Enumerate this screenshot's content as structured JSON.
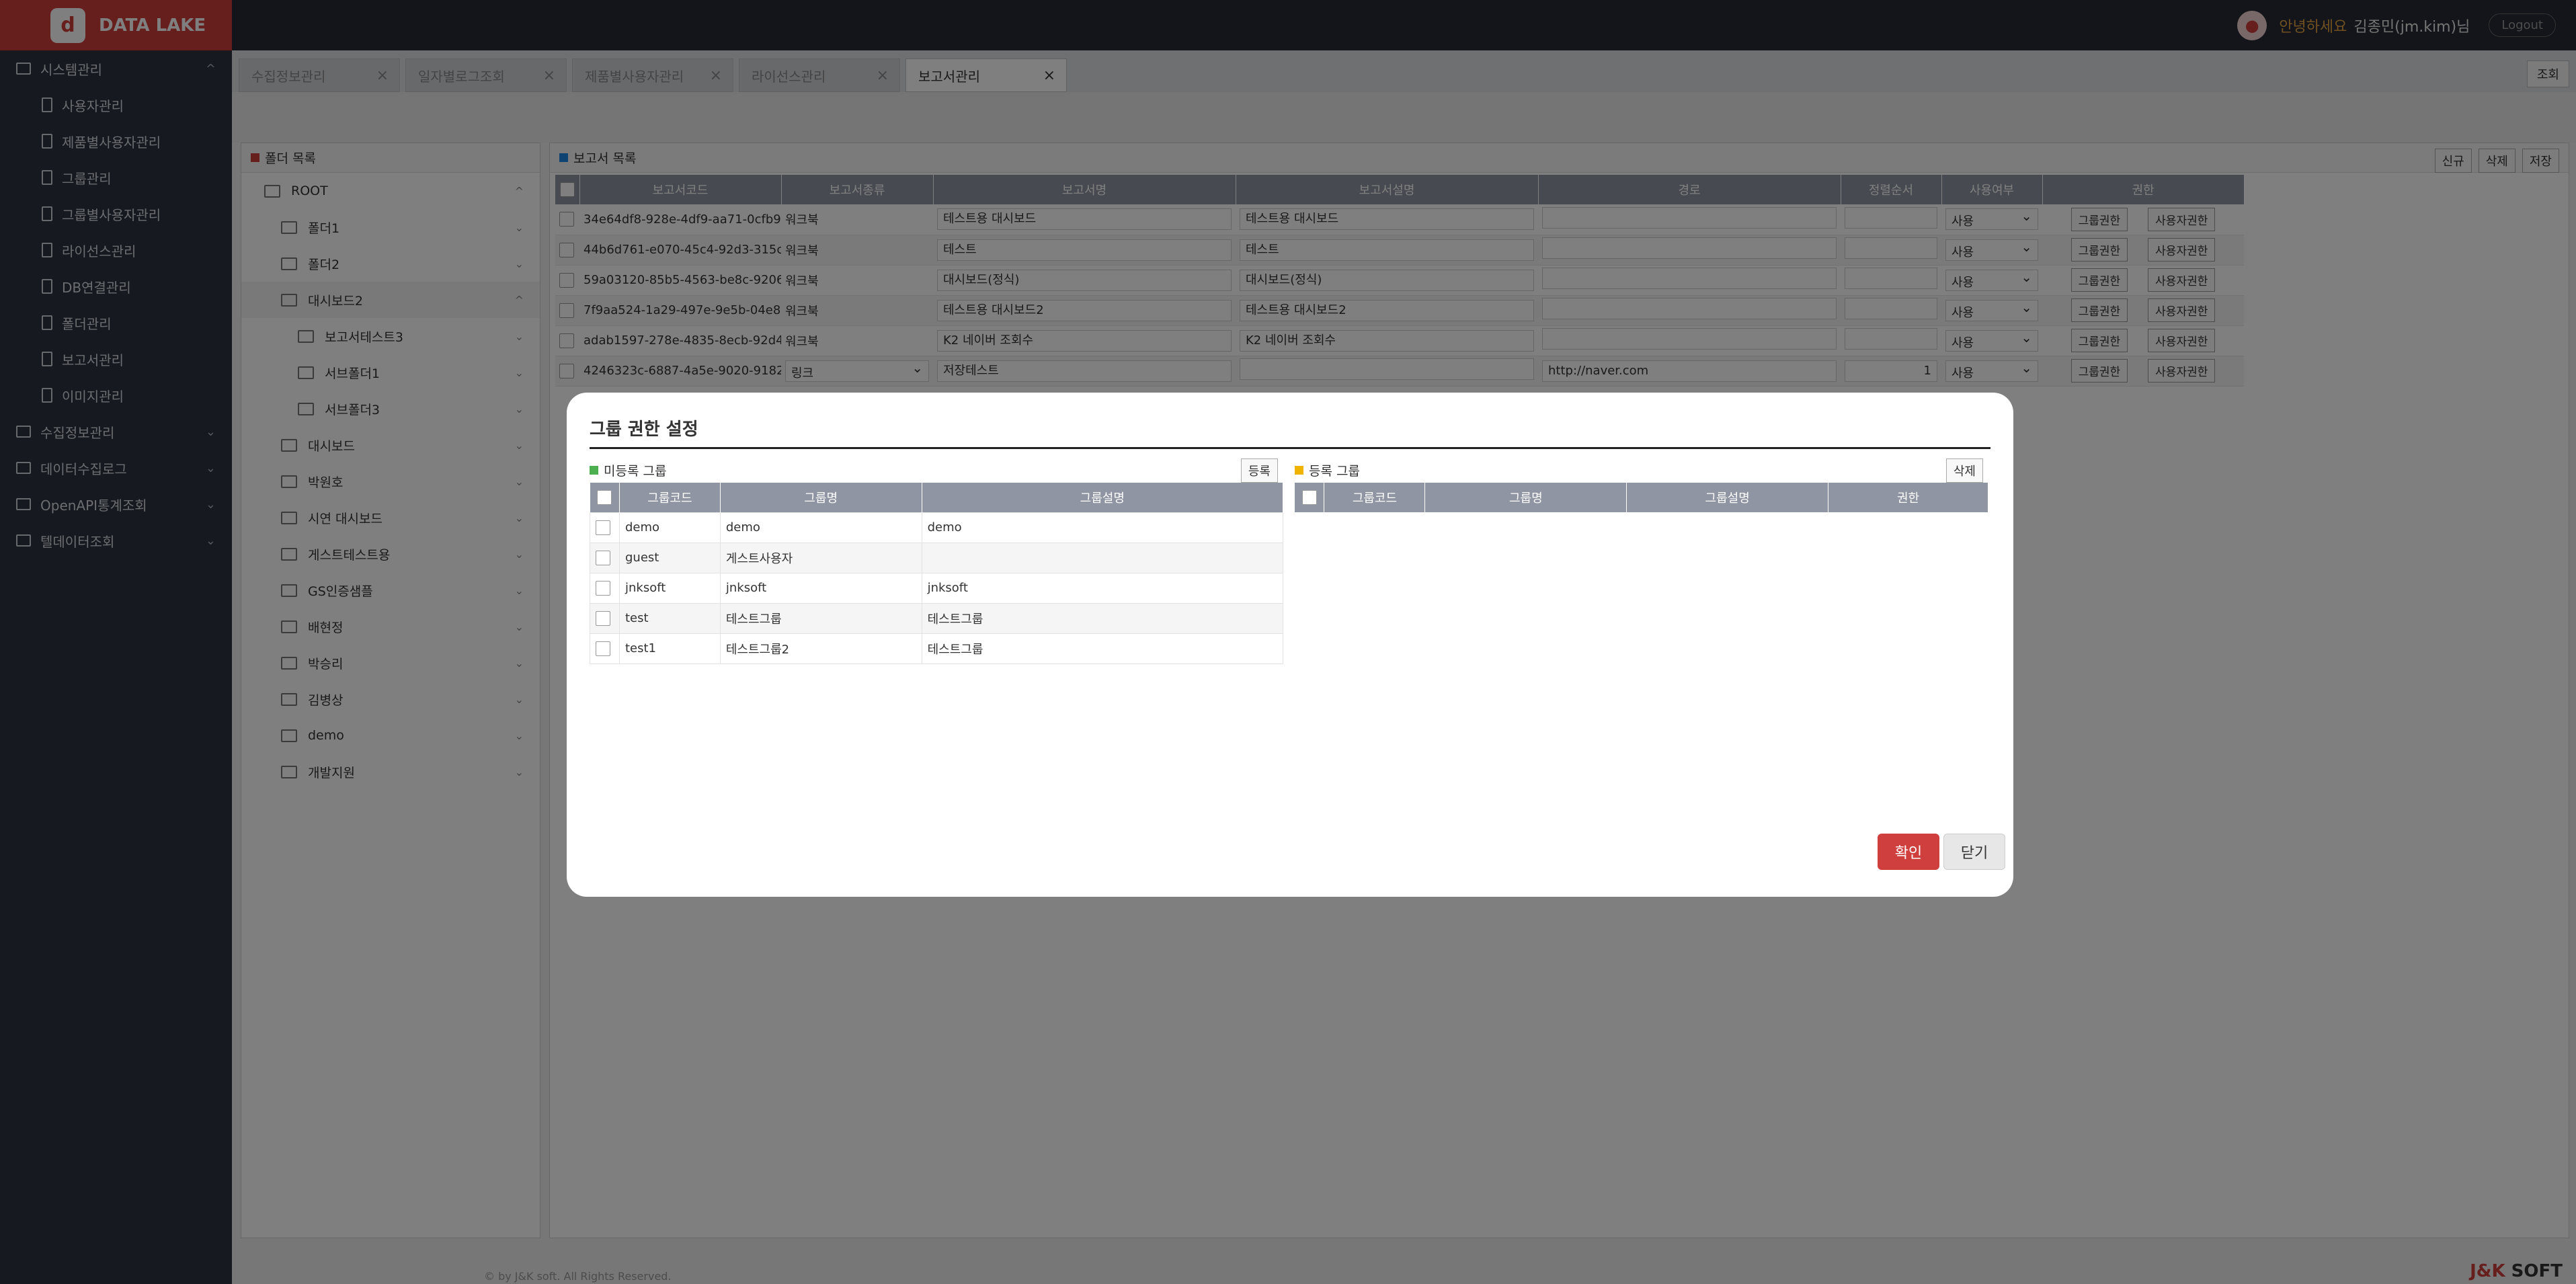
{
  "app": {
    "logo_text": "DATA LAKE",
    "logo_glyph": "d"
  },
  "topbar": {
    "greeting": "안녕하세요",
    "user": "김종민(jm.kim)님",
    "logout": "Logout"
  },
  "sidebar": {
    "groups": [
      {
        "label": "시스템관리",
        "expanded": true,
        "chevron": "^",
        "items": [
          "사용자관리",
          "제품별사용자관리",
          "그룹관리",
          "그룹별사용자관리",
          "라이선스관리",
          "DB연결관리",
          "폴더관리",
          "보고서관리",
          "이미지관리"
        ]
      },
      {
        "label": "수집정보관리",
        "chevron": "⌄"
      },
      {
        "label": "데이터수집로그",
        "chevron": "⌄"
      },
      {
        "label": "OpenAPI통계조회",
        "chevron": "⌄"
      },
      {
        "label": "텔데이터조회",
        "chevron": "⌄"
      }
    ]
  },
  "tabs": [
    {
      "label": "수집정보관리",
      "close": "×"
    },
    {
      "label": "일자별로그조회",
      "close": "×"
    },
    {
      "label": "제품별사용자관리",
      "close": "×"
    },
    {
      "label": "라이선스관리",
      "close": "×"
    },
    {
      "label": "보고서관리",
      "close": "×",
      "active": true
    }
  ],
  "view_button": "조회",
  "folder_panel": {
    "title": "폴더 목록",
    "tree": [
      {
        "label": "ROOT",
        "level": 0,
        "chev": "^"
      },
      {
        "label": "폴더1",
        "level": 1,
        "chev": "⌄"
      },
      {
        "label": "폴더2",
        "level": 1,
        "chev": "⌄"
      },
      {
        "label": "대시보드2",
        "level": 1,
        "chev": "^",
        "selected": true
      },
      {
        "label": "보고서테스트3",
        "level": 2,
        "chev": "⌄"
      },
      {
        "label": "서브폴더1",
        "level": 2,
        "chev": "⌄"
      },
      {
        "label": "서브폴더3",
        "level": 2,
        "chev": "⌄"
      },
      {
        "label": "대시보드",
        "level": 1,
        "chev": "⌄"
      },
      {
        "label": "박원호",
        "level": 1,
        "chev": "⌄"
      },
      {
        "label": "시연 대시보드",
        "level": 1,
        "chev": "⌄"
      },
      {
        "label": "게스트테스트용",
        "level": 1,
        "chev": "⌄"
      },
      {
        "label": "GS인증샘플",
        "level": 1,
        "chev": "⌄"
      },
      {
        "label": "배현정",
        "level": 1,
        "chev": "⌄"
      },
      {
        "label": "박승리",
        "level": 1,
        "chev": "⌄"
      },
      {
        "label": "김병상",
        "level": 1,
        "chev": "⌄"
      },
      {
        "label": "demo",
        "level": 1,
        "chev": "⌄"
      },
      {
        "label": "개발지원",
        "level": 1,
        "chev": "⌄"
      }
    ]
  },
  "report_panel": {
    "title": "보고서 목록",
    "actions": [
      "신규",
      "삭제",
      "저장"
    ],
    "columns": [
      "보고서코드",
      "보고서종류",
      "보고서명",
      "보고서설명",
      "경로",
      "정렬순서",
      "사용여부",
      "권한"
    ],
    "rows": [
      {
        "code": "34e64df8-928e-4df9-aa71-0cfb9...",
        "type": "워크북",
        "name": "테스트용 대시보드",
        "desc": "테스트용 대시보드",
        "path": "",
        "order": "",
        "use": "사용"
      },
      {
        "code": "44b6d761-e070-45c4-92d3-315c...",
        "type": "워크북",
        "name": "테스트",
        "desc": "테스트",
        "path": "",
        "order": "",
        "use": "사용"
      },
      {
        "code": "59a03120-85b5-4563-be8c-9206...",
        "type": "워크북",
        "name": "대시보드(정식)",
        "desc": "대시보드(정식)",
        "path": "",
        "order": "",
        "use": "사용"
      },
      {
        "code": "7f9aa524-1a29-497e-9e5b-04e8...",
        "type": "워크북",
        "name": "테스트용 대시보드2",
        "desc": "테스트용 대시보드2",
        "path": "",
        "order": "",
        "use": "사용"
      },
      {
        "code": "adab1597-278e-4835-8ecb-92d4...",
        "type": "워크북",
        "name": "K2 네이버 조회수",
        "desc": "K2 네이버 조회수",
        "path": "",
        "order": "",
        "use": "사용"
      },
      {
        "code": "4246323c-6887-4a5e-9020-9182...",
        "type": "링크",
        "name": "저장테스트",
        "desc": "",
        "path": "http://naver.com",
        "order": "1",
        "use": "사용"
      }
    ],
    "group_btn": "그룹권한",
    "user_btn": "사용자권한"
  },
  "modal": {
    "title": "그룹 권한 설정",
    "left": {
      "title": "미등록 그룹",
      "button": "등록",
      "columns": [
        "그룹코드",
        "그룹명",
        "그룹설명"
      ],
      "rows": [
        [
          "demo",
          "demo",
          "demo"
        ],
        [
          "guest",
          "게스트사용자",
          ""
        ],
        [
          "jnksoft",
          "jnksoft",
          "jnksoft"
        ],
        [
          "test",
          "테스트그룹",
          "테스트그룹"
        ],
        [
          "test1",
          "테스트그룹2",
          "테스트그룹"
        ]
      ]
    },
    "right": {
      "title": "등록 그룹",
      "button": "삭제",
      "columns": [
        "그룹코드",
        "그룹명",
        "그룹설명",
        "권한"
      ]
    },
    "ok": "확인",
    "close": "닫기"
  },
  "footer": "© by J&K soft. All Rights Reserved.",
  "brand": {
    "a": "J&K",
    "b": " SOFT"
  },
  "colors": {
    "accent": "#cf3f3d",
    "sidebar": "#2c3341",
    "header_cell": "#8f95a3",
    "left_marker": "#4caf50",
    "right_marker": "#f0b400",
    "folder_marker": "#cf3f3d",
    "report_marker": "#1e88e5"
  }
}
